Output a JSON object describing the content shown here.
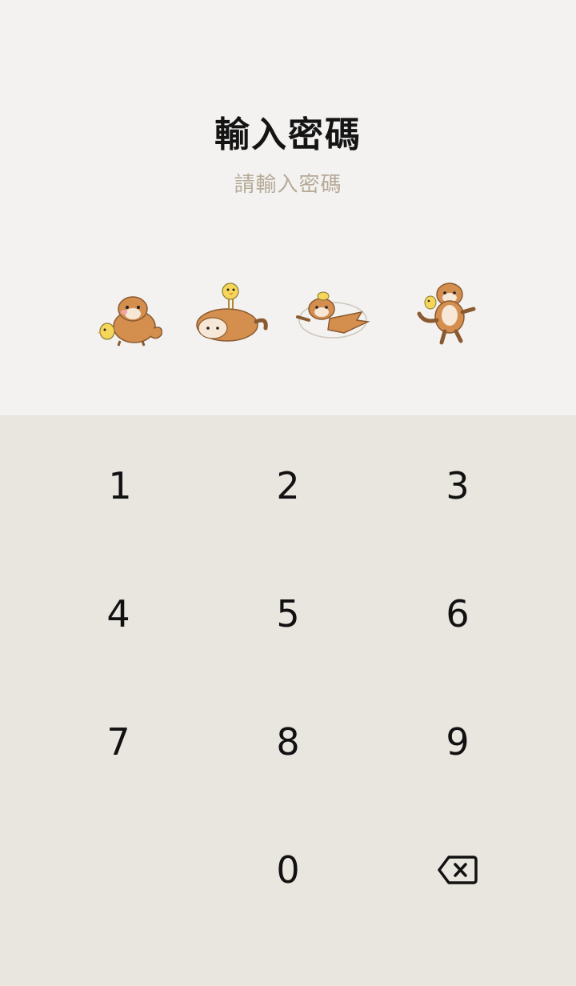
{
  "header": {
    "title": "輸入密碼",
    "subtitle": "請輸入密碼"
  },
  "indicators": [
    {
      "name": "passcode-slot-1",
      "icon": "otter-with-chick-sticker"
    },
    {
      "name": "passcode-slot-2",
      "icon": "otter-bowing-with-chick-sticker"
    },
    {
      "name": "passcode-slot-3",
      "icon": "otter-spinning-sticker"
    },
    {
      "name": "passcode-slot-4",
      "icon": "otter-jumping-with-chick-sticker"
    }
  ],
  "keypad": {
    "k1": "1",
    "k2": "2",
    "k3": "3",
    "k4": "4",
    "k5": "5",
    "k6": "6",
    "k7": "7",
    "k8": "8",
    "k9": "9",
    "k0": "0",
    "backspace_icon": "backspace-icon"
  },
  "colors": {
    "top_background": "#f3f2f0",
    "keypad_background": "#e9e5df",
    "subtitle": "#b6aa98",
    "otter": "#d48e4e"
  }
}
